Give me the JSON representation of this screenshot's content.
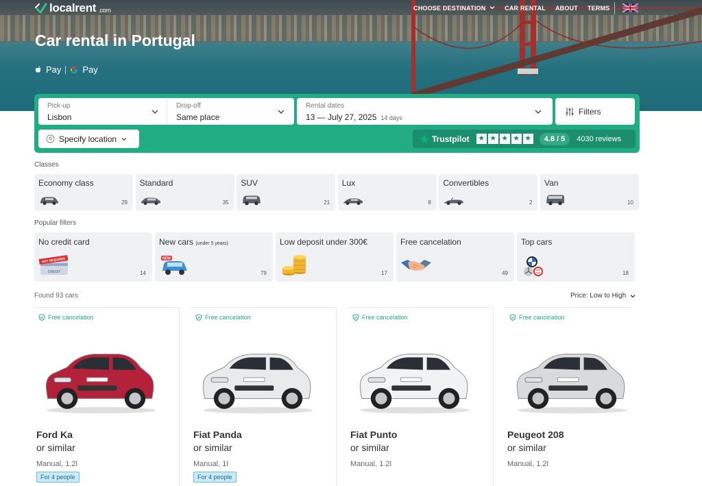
{
  "nav": {
    "logo_text": "localrent",
    "logo_suffix": ".com",
    "menu": [
      "CHOOSE DESTINATION",
      "CAR RENTAL",
      "ABOUT",
      "TERMS"
    ]
  },
  "hero": {
    "title": "Car rental in Portugal",
    "apple_pay": "Pay",
    "google_pay": "Pay"
  },
  "search": {
    "pickup_label": "Pick-up",
    "pickup_value": "Lisbon",
    "dropoff_label": "Drop-off",
    "dropoff_value": "Same place",
    "dates_label": "Rental dates",
    "dates_value": "13 — July 27, 2025",
    "days": "14 days",
    "filters_label": "Filters",
    "specify_location": "Specify location",
    "trustpilot": "Trustpilot",
    "rating": "4.8 / 5",
    "reviews": "4030 reviews",
    "accent_color": "#21ac83"
  },
  "classes": {
    "label": "Classes",
    "items": [
      {
        "name": "Economy class",
        "count": "29"
      },
      {
        "name": "Standard",
        "count": "35"
      },
      {
        "name": "SUV",
        "count": "21"
      },
      {
        "name": "Lux",
        "count": "8"
      },
      {
        "name": "Convertibles",
        "count": "2"
      },
      {
        "name": "Van",
        "count": "10"
      }
    ]
  },
  "popular": {
    "label": "Popular filters",
    "items": [
      {
        "name": "No credit card",
        "note": "",
        "count": "14",
        "badge": "NOT REQUIRED",
        "card_text": "CREDIT"
      },
      {
        "name": "New cars",
        "note": "(under 5 years)",
        "count": "79",
        "badge": "NEW",
        "card_text": ""
      },
      {
        "name": "Low deposit under 300€",
        "note": "",
        "count": "17",
        "badge": "",
        "card_text": ""
      },
      {
        "name": "Free cancelation",
        "note": "",
        "count": "49",
        "badge": "",
        "card_text": ""
      },
      {
        "name": "Top cars",
        "note": "",
        "count": "18",
        "badge": "",
        "card_text": ""
      }
    ]
  },
  "results": {
    "found": "Found 93 cars",
    "sort": "Price: Low to High",
    "cars": [
      {
        "free": "Free cancelation",
        "name": "Ford Ka",
        "similar": "or similar",
        "spec": "Manual, 1.2l",
        "people": "For 4 people",
        "color": "#b3223a"
      },
      {
        "free": "Free cancelation",
        "name": "Fiat Panda",
        "similar": "or similar",
        "spec": "Manual, 1l",
        "people": "For 4 people",
        "color": "#e9eaeb"
      },
      {
        "free": "Free cancelation",
        "name": "Fiat Punto",
        "similar": "or similar",
        "spec": "Manual, 1.2l",
        "people": "",
        "color": "#f1f2f3"
      },
      {
        "free": "Free cancelation",
        "name": "Peugeot 208",
        "similar": "or similar",
        "spec": "Manual, 1.2l",
        "people": "",
        "color": "#d9dadc"
      }
    ]
  }
}
